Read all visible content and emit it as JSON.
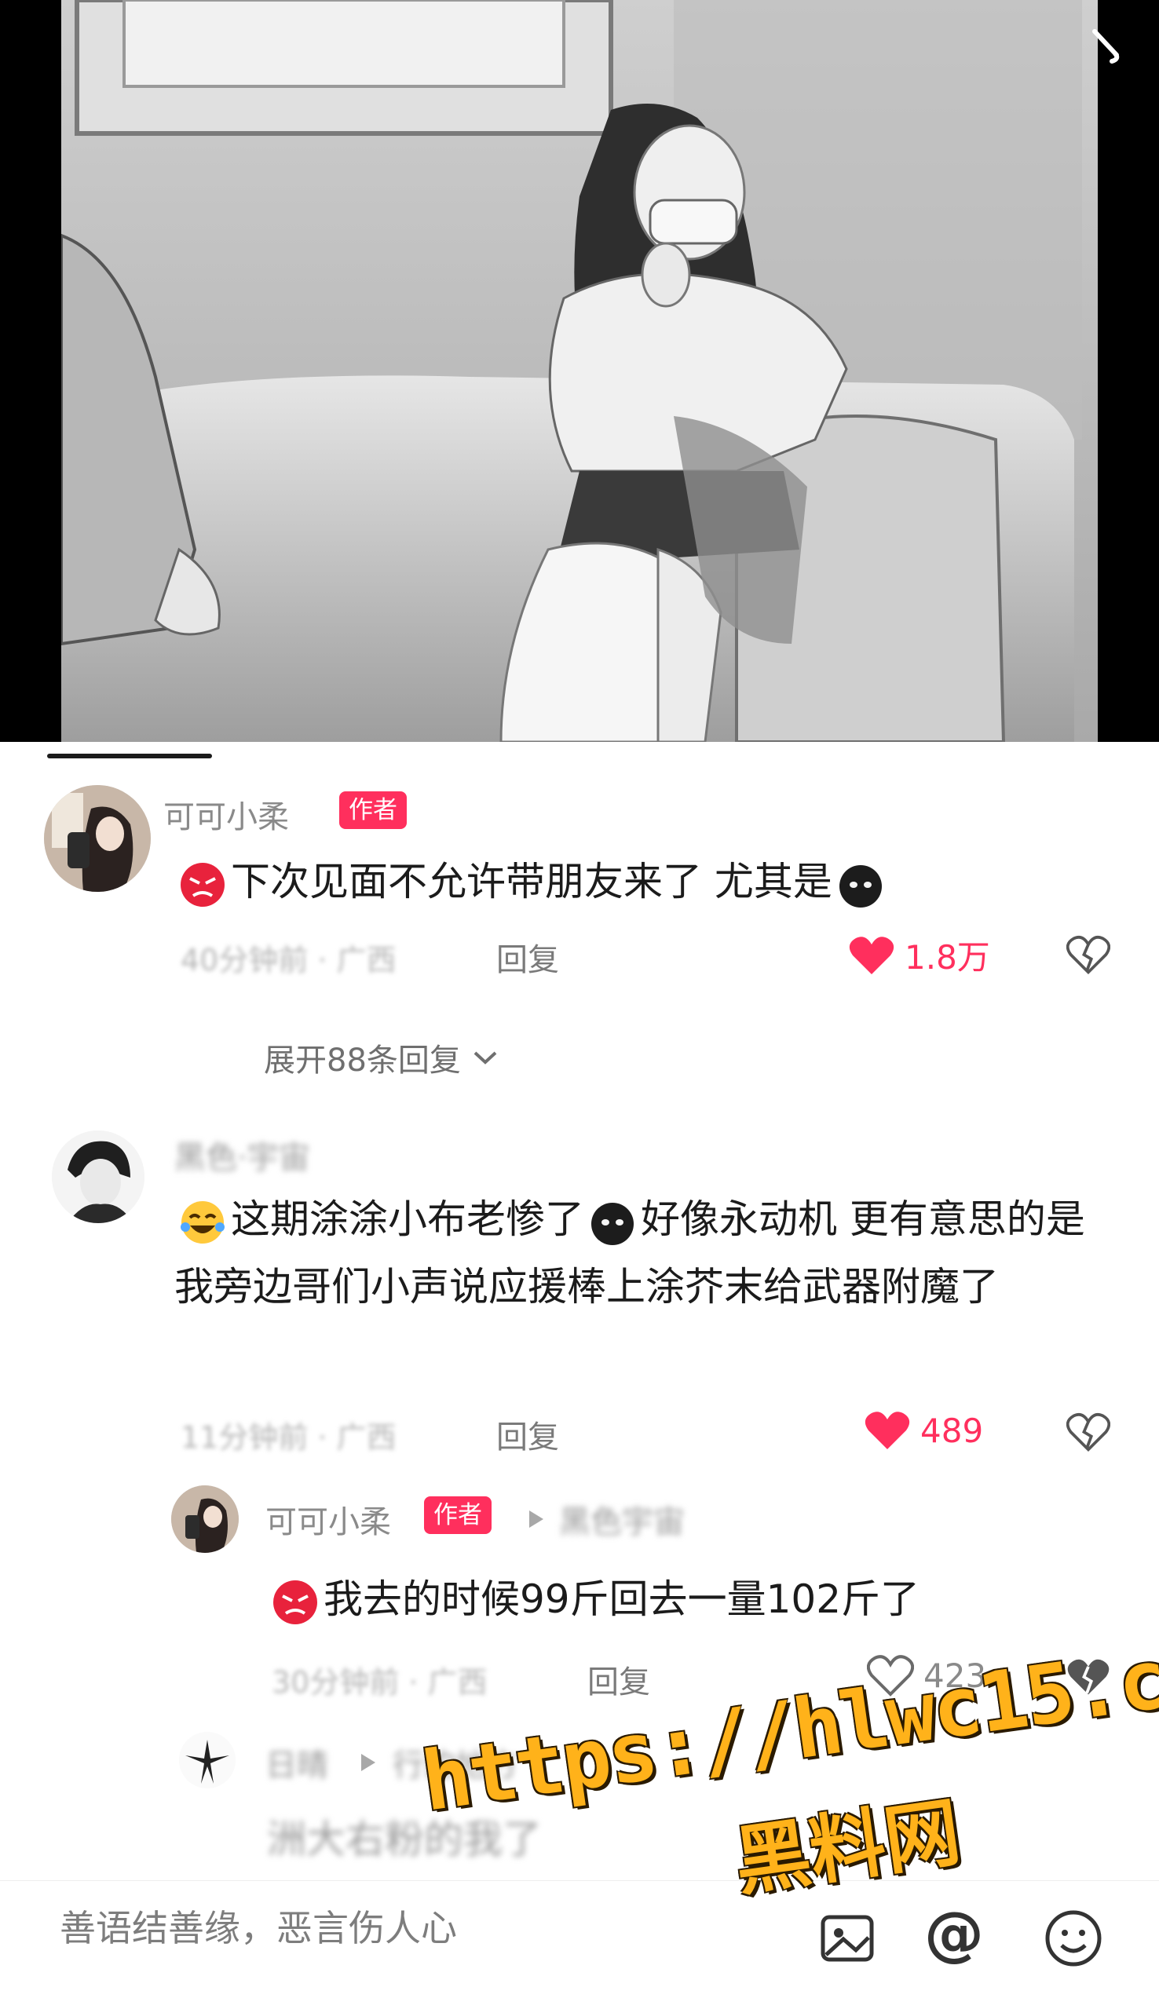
{
  "comments": [
    {
      "username": "可可小柔",
      "author_badge": "作者",
      "avatar_icon": "user-avatar-girl",
      "text": "下次见面不允许带朋友来了 尤其是",
      "lead_emoji": "angry-face-emoji",
      "trail_emoji": "dark-face-emoji",
      "meta": "40分钟前 · 广西",
      "reply_label": "回复",
      "likes": "1.8万",
      "liked": true,
      "expand_label": "展开88条回复"
    },
    {
      "username": "黑色·宇宙",
      "avatar_icon": "user-avatar-boy",
      "text_part1": "这期涂涂小布老惨了",
      "text_part2": "好像永动机 更有意思的是我旁边哥们小声说应援棒上涂芥末给武器附魔了",
      "lead_emoji": "laughing-tears-emoji",
      "mid_emoji": "dark-face-emoji",
      "meta": "11分钟前 · 广西",
      "reply_label": "回复",
      "likes": "489",
      "liked": true
    }
  ],
  "reply": {
    "username": "可可小柔",
    "author_badge": "作者",
    "reply_to": "黑色宇宙",
    "text": "我去的时候99斤回去一量102斤了",
    "lead_emoji": "angry-face-emoji",
    "meta": "30分钟前 · 广西",
    "reply_label": "回复",
    "likes": "423",
    "liked": false
  },
  "reply2": {
    "username": "日晴",
    "reply_to": "行的地方",
    "text": "洲大右粉的我了"
  },
  "bottom_bar": {
    "placeholder": "善语结善缘，恶言伤人心",
    "icons": [
      "image-icon",
      "at-icon",
      "emoji-icon"
    ],
    "at_symbol": "@"
  },
  "watermark": {
    "line1": "https://hlwc15.com",
    "line2": "黑料网"
  },
  "colors": {
    "accent": "#ff2f5d",
    "watermark": "#ffb21a"
  }
}
